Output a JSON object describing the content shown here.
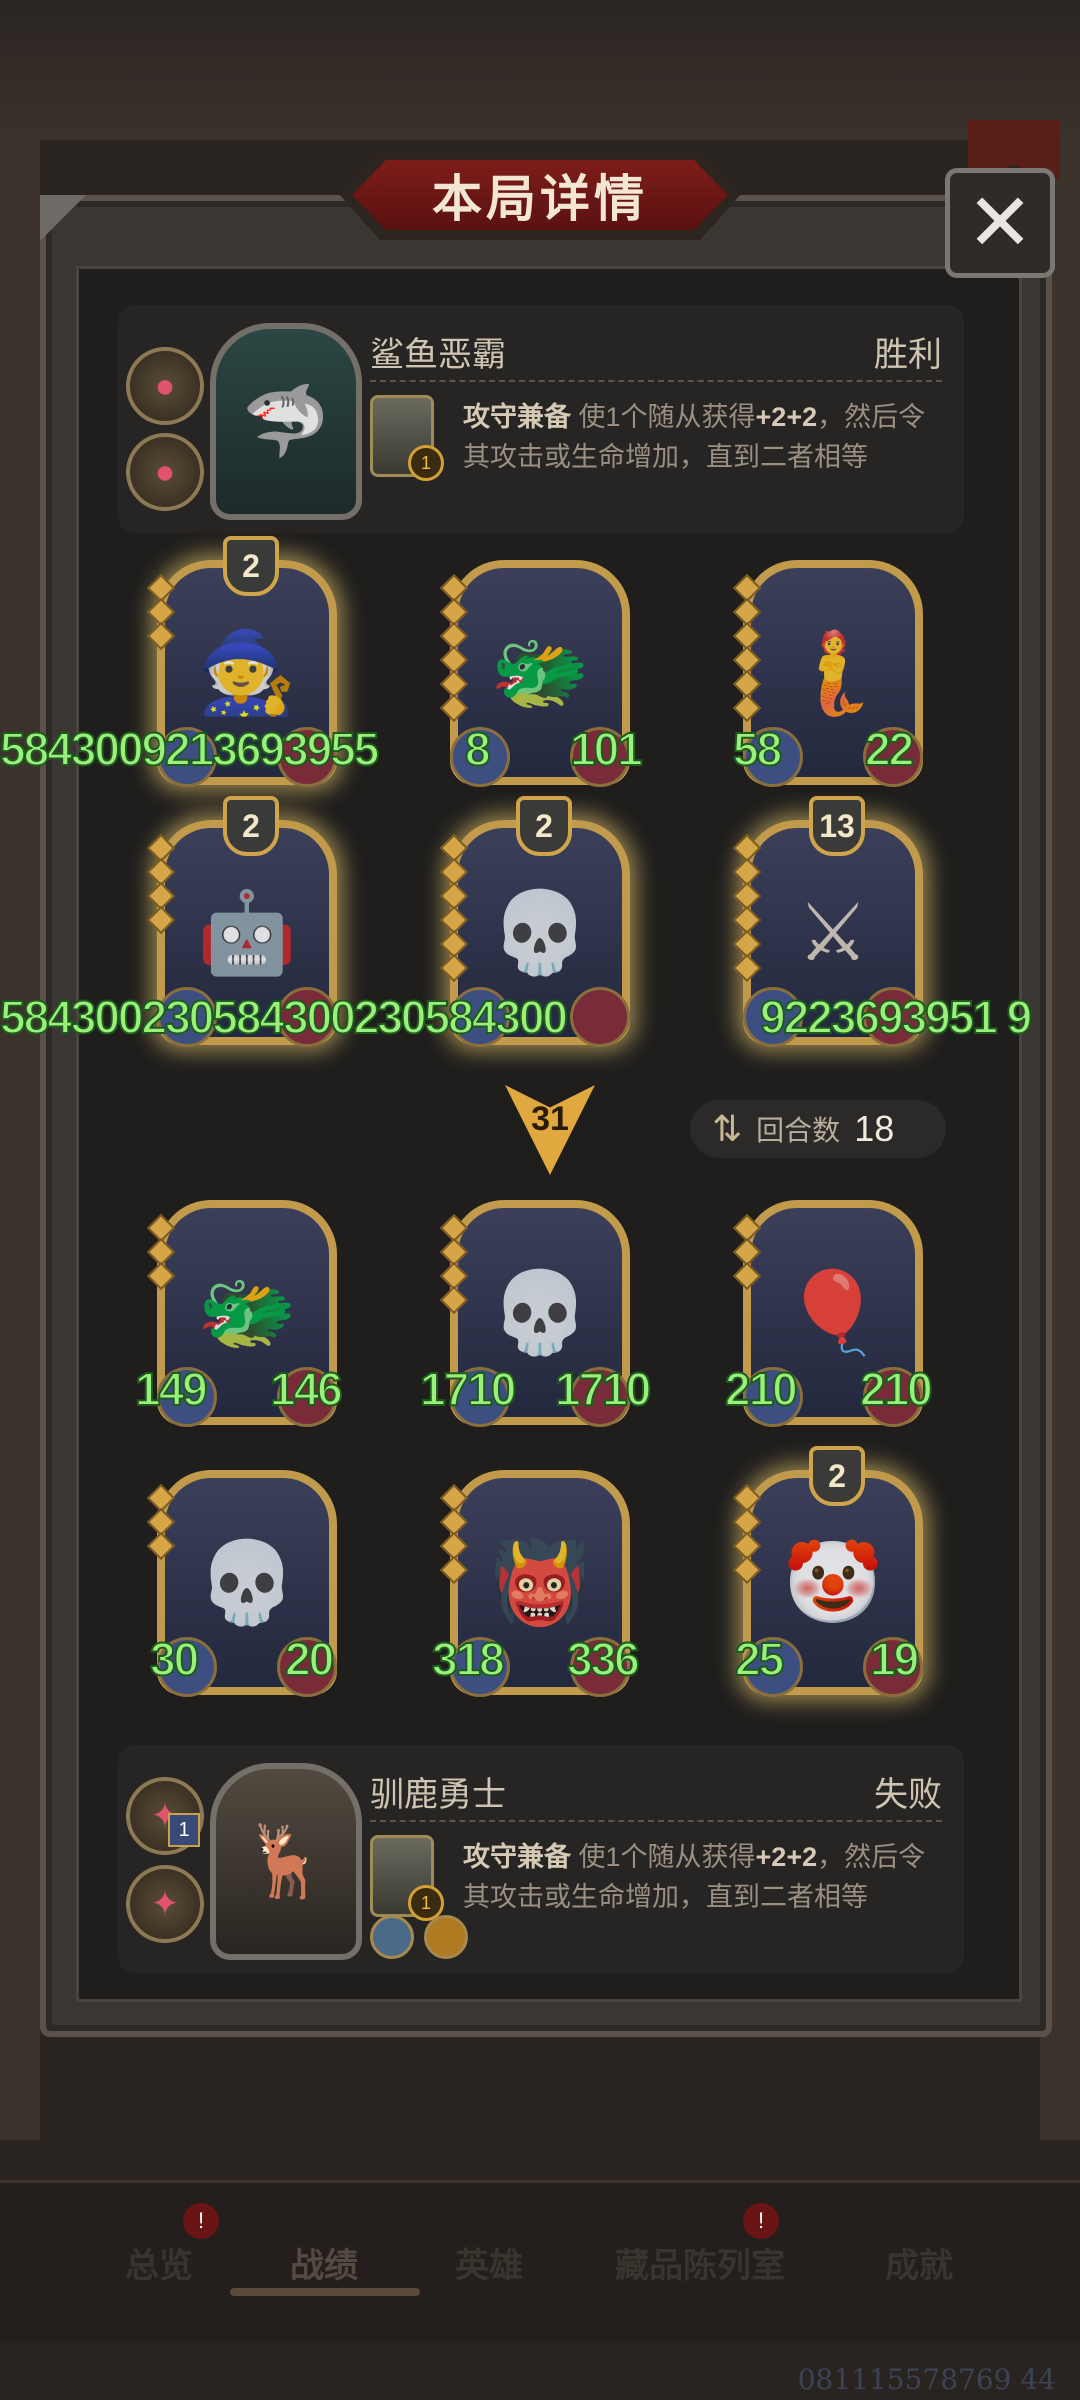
{
  "dialog": {
    "title": "本局详情",
    "close_icon": "✕"
  },
  "top_player": {
    "name": "鲨鱼恶霸",
    "result": "胜利",
    "mini_badge": "1",
    "skill": {
      "name": "攻守兼备",
      "text_a": " 使1个随从获得",
      "bonus": "+2+2",
      "text_b": "，然后令其攻击或生命增加，直到二者相等"
    }
  },
  "bottom_player": {
    "name": "驯鹿勇士",
    "result": "失败",
    "orb_badge": "1",
    "mini_badge": "1",
    "skill": {
      "name": "攻守兼备",
      "text_a": " 使1个随从获得",
      "bonus": "+2+2",
      "text_b": "，然后令其攻击或生命增加，直到二者相等"
    }
  },
  "top_board": {
    "row1": {
      "card1_star": "2",
      "overlay": "5843009213693955",
      "card2_atk": "8",
      "card2_hp": "101",
      "card3_atk": "58",
      "card3_hp": "22"
    },
    "row2": {
      "card1_star": "2",
      "card2_star": "2",
      "card3_star": "13",
      "overlay": "584300230584300230584300",
      "overlay_tail": "9223693951 9"
    }
  },
  "battle": {
    "arrow_value": "31",
    "rounds_label": "回合数",
    "rounds_value": "18"
  },
  "bottom_board": {
    "row1": [
      {
        "atk": "149",
        "hp": "146"
      },
      {
        "atk": "1710",
        "hp": "1710"
      },
      {
        "atk": "210",
        "hp": "210"
      }
    ],
    "row2": [
      {
        "atk": "30",
        "hp": "20"
      },
      {
        "atk": "318",
        "hp": "336"
      },
      {
        "atk": "25",
        "hp": "19",
        "star": "2"
      }
    ]
  },
  "nav": {
    "items": [
      "总览",
      "战绩",
      "英雄",
      "藏品陈列室",
      "成就"
    ],
    "badge": "!"
  },
  "footer_code": "081115578769 44"
}
